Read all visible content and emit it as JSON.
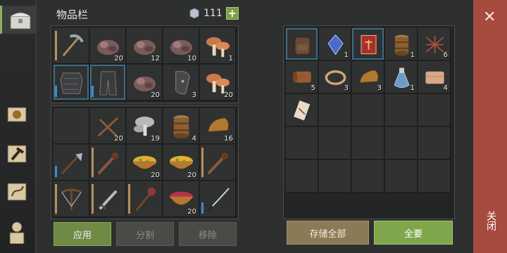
{
  "header": {
    "title": "物品栏",
    "coins": "111",
    "plus_label": "+"
  },
  "left_panel": {
    "rows": [
      [
        {
          "icon": "pickaxe-icon",
          "count": "",
          "bar": "tan"
        },
        {
          "icon": "ore-icon",
          "count": "20"
        },
        {
          "icon": "ore-icon",
          "count": "12"
        },
        {
          "icon": "ore-icon",
          "count": "10"
        },
        {
          "icon": "mushroom-icon",
          "count": "1"
        }
      ],
      [
        {
          "icon": "armor-chest-icon",
          "count": "",
          "sel": true,
          "bar": "blue"
        },
        {
          "icon": "armor-pants-icon",
          "count": "",
          "sel": true,
          "bar": "blue"
        },
        {
          "icon": "ore-icon",
          "count": "20"
        },
        {
          "icon": "shield-plate-icon",
          "count": "3"
        },
        {
          "icon": "mushroom-icon",
          "count": "20"
        }
      ],
      [
        {
          "icon": "",
          "count": ""
        },
        {
          "icon": "sticks-icon",
          "count": "20"
        },
        {
          "icon": "grey-mushroom-icon",
          "count": "19"
        },
        {
          "icon": "barrel-icon",
          "count": "4"
        },
        {
          "icon": "bread-icon",
          "count": "16"
        }
      ],
      [
        {
          "icon": "halberd-icon",
          "count": "",
          "bar": "blue"
        },
        {
          "icon": "spiked-club-icon",
          "count": "",
          "bar": "tan"
        },
        {
          "icon": "soup-bowl-icon",
          "count": "20"
        },
        {
          "icon": "soup-bowl-icon",
          "count": "20"
        },
        {
          "icon": "spiked-club-icon",
          "count": "",
          "bar": "tan"
        }
      ],
      [
        {
          "icon": "crossbow-icon",
          "count": "",
          "bar": "tan"
        },
        {
          "icon": "sword-icon",
          "count": "",
          "bar": "tan"
        },
        {
          "icon": "mace-icon",
          "count": "",
          "bar": "tan"
        },
        {
          "icon": "berry-bowl-icon",
          "count": "20"
        },
        {
          "icon": "katana-icon",
          "count": "",
          "bar": "blue"
        }
      ]
    ],
    "buttons": {
      "apply": "应用",
      "split": "分割",
      "remove": "移除"
    }
  },
  "right_panel": {
    "rows": [
      [
        {
          "icon": "backpack-icon",
          "count": "",
          "sel": true
        },
        {
          "icon": "crystal-icon",
          "count": "1"
        },
        {
          "icon": "red-book-icon",
          "count": "",
          "sel": true
        },
        {
          "icon": "barrel-icon",
          "count": "1"
        },
        {
          "icon": "net-icon",
          "count": "6"
        }
      ],
      [
        {
          "icon": "leather-roll-icon",
          "count": "5"
        },
        {
          "icon": "rope-icon",
          "count": "3"
        },
        {
          "icon": "bread-icon",
          "count": "3"
        },
        {
          "icon": "potion-icon",
          "count": "1"
        },
        {
          "icon": "cloth-icon",
          "count": "4"
        }
      ],
      [
        {
          "icon": "scroll-icon",
          "count": ""
        },
        {
          "icon": "",
          "count": ""
        },
        {
          "icon": "",
          "count": ""
        },
        {
          "icon": "",
          "count": ""
        },
        {
          "icon": "",
          "count": ""
        }
      ],
      [
        {
          "icon": "",
          "count": ""
        },
        {
          "icon": "",
          "count": ""
        },
        {
          "icon": "",
          "count": ""
        },
        {
          "icon": "",
          "count": ""
        },
        {
          "icon": "",
          "count": ""
        }
      ],
      [
        {
          "icon": "",
          "count": ""
        },
        {
          "icon": "",
          "count": ""
        },
        {
          "icon": "",
          "count": ""
        },
        {
          "icon": "",
          "count": ""
        },
        {
          "icon": "",
          "count": ""
        }
      ]
    ],
    "buttons": {
      "store_all": "存储全部",
      "take_all": "全要"
    }
  },
  "close": {
    "x": "✕",
    "label": "关闭"
  }
}
